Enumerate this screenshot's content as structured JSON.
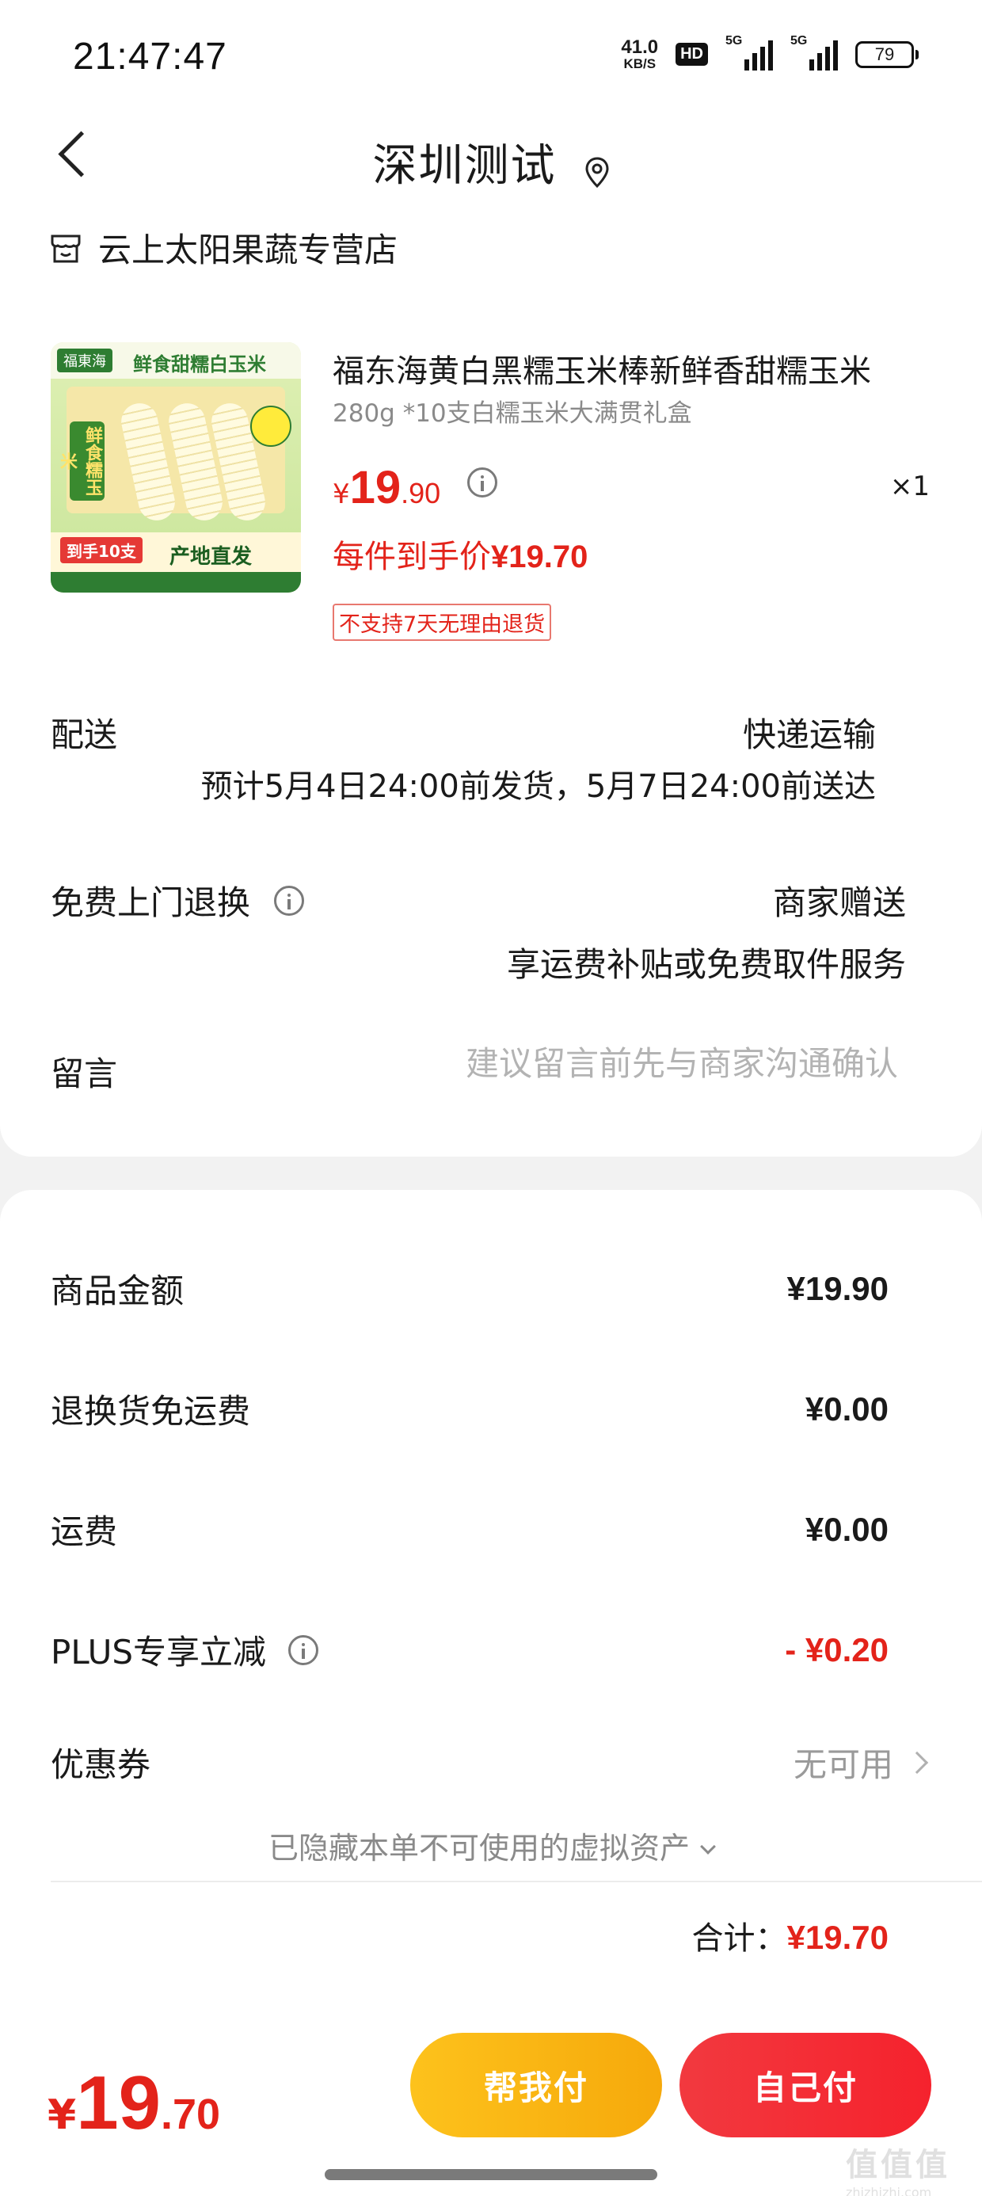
{
  "status_bar": {
    "time": "21:47:47",
    "net_speed_value": "41.0",
    "net_speed_unit": "KB/S",
    "hd_badge": "HD",
    "signal1_label": "5G",
    "signal2_label": "5G",
    "battery": "79"
  },
  "header": {
    "title": "深圳测试",
    "back_icon": "chevron-left-icon",
    "location_icon": "location-pin-icon"
  },
  "shop": {
    "icon": "store-icon",
    "name": "云上太阳果蔬专营店"
  },
  "product": {
    "image_brand": "福東海",
    "image_headline": "鲜食甜糯白玉米",
    "image_badge_vertical": "鲜食糯玉米",
    "image_tag": "到手10支",
    "image_origin": "产地直发",
    "title": "福东海黄白黑糯玉米棒新鲜香甜糯玉米",
    "spec": "280g *10支白糯玉米大满贯礼盒",
    "price_currency": "¥",
    "price_int": "19",
    "price_dec": ".90",
    "quantity": "×1",
    "final_price_label": "每件到手价",
    "final_price_value": "¥19.70",
    "return_policy_badge": "不支持7天无理由退货"
  },
  "delivery": {
    "label": "配送",
    "method": "快递运输",
    "estimate": "预计5月4日24:00前发货，5月7日24:00前送达"
  },
  "return_service": {
    "label": "免费上门退换",
    "provider": "商家赠送",
    "description": "享运费补贴或免费取件服务"
  },
  "message": {
    "label": "留言",
    "placeholder": "建议留言前先与商家沟通确认",
    "value": ""
  },
  "summary": {
    "goods_amount_label": "商品金额",
    "goods_amount": "¥19.90",
    "return_shipping_label": "退换货免运费",
    "return_shipping": "¥0.00",
    "shipping_label": "运费",
    "shipping": "¥0.00",
    "plus_discount_label": "PLUS专享立减",
    "plus_discount": "- ¥0.20",
    "coupon_label": "优惠券",
    "coupon_value": "无可用",
    "hidden_assets_text": "已隐藏本单不可使用的虚拟资产",
    "total_label": "合计：",
    "total_amount": "¥19.70"
  },
  "pay_bar": {
    "currency": "¥",
    "amount_int": "19",
    "amount_dec": ".70",
    "friend_pay_label": "帮我付",
    "self_pay_label": "自己付"
  },
  "watermark": {
    "glyphs": "值值值",
    "url": "zhizhizhi.com"
  },
  "colors": {
    "price_red": "#e3231a",
    "friend_pay_yellow": "#fdc21c",
    "self_pay_red": "#f2393f"
  }
}
